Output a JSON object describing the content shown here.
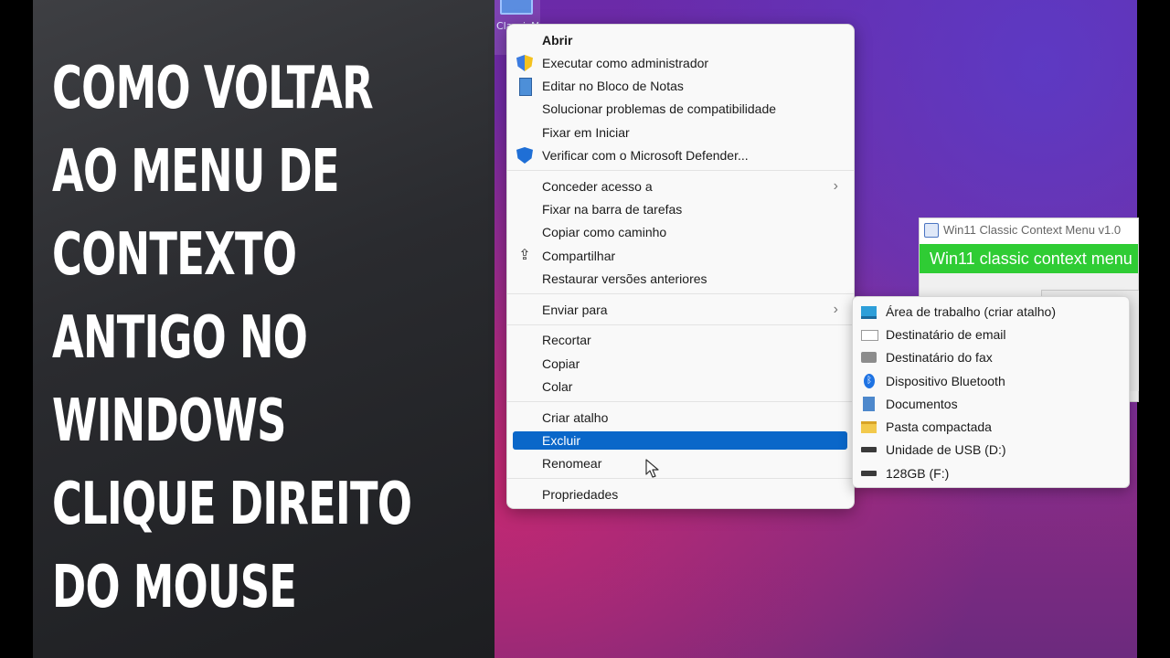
{
  "headline": {
    "lines": [
      "COMO VOLTAR",
      "AO MENU DE",
      "CONTEXTO",
      "ANTIGO NO",
      "WINDOWS",
      "CLIQUE DIREITO",
      "DO MOUSE"
    ]
  },
  "desktop": {
    "icon_label": "ClassicM en"
  },
  "context_menu": {
    "items": [
      {
        "label": "Abrir",
        "icon": "none"
      },
      {
        "label": "Executar como administrador",
        "icon": "uac-shield-icon"
      },
      {
        "label": "Editar no Bloco de Notas",
        "icon": "notepad-icon"
      },
      {
        "label": "Solucionar problemas de compatibilidade",
        "icon": "none"
      },
      {
        "label": "Fixar em Iniciar",
        "icon": "none"
      },
      {
        "label": "Verificar com o Microsoft Defender...",
        "icon": "defender-shield-icon"
      },
      {
        "label": "Conceder acesso a",
        "icon": "none",
        "submenu": true
      },
      {
        "label": "Fixar na barra de tarefas",
        "icon": "none"
      },
      {
        "label": "Copiar como caminho",
        "icon": "none"
      },
      {
        "label": "Compartilhar",
        "icon": "share-icon"
      },
      {
        "label": "Restaurar versões anteriores",
        "icon": "none"
      },
      {
        "label": "Enviar para",
        "icon": "none",
        "submenu": true
      },
      {
        "label": "Recortar",
        "icon": "none"
      },
      {
        "label": "Copiar",
        "icon": "none"
      },
      {
        "label": "Colar",
        "icon": "none"
      },
      {
        "label": "Criar atalho",
        "icon": "none"
      },
      {
        "label": "Excluir",
        "icon": "none",
        "selected": true
      },
      {
        "label": "Renomear",
        "icon": "none"
      },
      {
        "label": "Propriedades",
        "icon": "none"
      }
    ],
    "submenu_arrow": "›"
  },
  "send_to_menu": {
    "items": [
      {
        "label": "Área de trabalho (criar atalho)",
        "icon": "desktop-icon"
      },
      {
        "label": "Destinatário de email",
        "icon": "mail-icon"
      },
      {
        "label": "Destinatário do fax",
        "icon": "fax-icon"
      },
      {
        "label": "Dispositivo Bluetooth",
        "icon": "bluetooth-icon"
      },
      {
        "label": "Documentos",
        "icon": "documents-icon"
      },
      {
        "label": "Pasta compactada",
        "icon": "zip-folder-icon"
      },
      {
        "label": "Unidade de USB (D:)",
        "icon": "usb-drive-icon"
      },
      {
        "label": "128GB (F:)",
        "icon": "drive-icon"
      }
    ]
  },
  "app_window": {
    "title": "Win11 Classic Context Menu v1.0",
    "banner": "Win11 classic context menu"
  },
  "colors": {
    "selection": "#0a67c9",
    "banner_green": "#2fcc34"
  }
}
